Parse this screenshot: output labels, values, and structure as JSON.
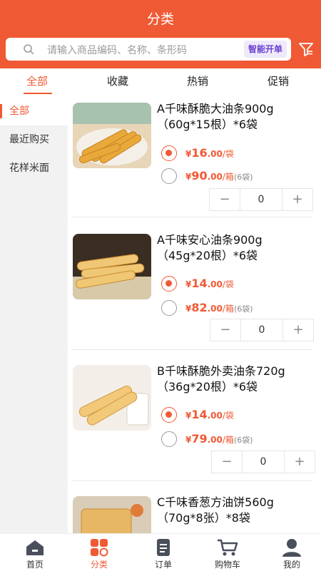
{
  "header": {
    "title": "分类"
  },
  "search": {
    "placeholder": "请输入商品编码、名称、条形码",
    "smart_button": "智能开单"
  },
  "icons": {
    "search": "search-icon",
    "filter": "filter-icon"
  },
  "colors": {
    "accent": "#ef5a34",
    "sidebar_bg": "#f2f2f2"
  },
  "tabs": [
    {
      "label": "全部",
      "active": true
    },
    {
      "label": "收藏",
      "active": false
    },
    {
      "label": "热销",
      "active": false
    },
    {
      "label": "促销",
      "active": false
    }
  ],
  "sidebar": {
    "items": [
      {
        "label": "全部",
        "active": true
      },
      {
        "label": "最近购买",
        "active": false
      },
      {
        "label": "花样米面",
        "active": false
      }
    ]
  },
  "products": [
    {
      "name": "A千味酥脆大油条900g（60g*15根）*6袋",
      "prices": [
        {
          "currency": "¥",
          "int": "16",
          "dec": ".00",
          "unit": "/袋",
          "note": "",
          "selected": true
        },
        {
          "currency": "¥",
          "int": "90",
          "dec": ".00",
          "unit": "/箱",
          "note": "(6袋)",
          "selected": false
        }
      ],
      "qty": "0"
    },
    {
      "name": "A千味安心油条900g（45g*20根）*6袋",
      "prices": [
        {
          "currency": "¥",
          "int": "14",
          "dec": ".00",
          "unit": "/袋",
          "note": "",
          "selected": true
        },
        {
          "currency": "¥",
          "int": "82",
          "dec": ".00",
          "unit": "/箱",
          "note": "(6袋)",
          "selected": false
        }
      ],
      "qty": "0"
    },
    {
      "name": "B千味酥脆外卖油条720g（36g*20根）*6袋",
      "prices": [
        {
          "currency": "¥",
          "int": "14",
          "dec": ".00",
          "unit": "/袋",
          "note": "",
          "selected": true
        },
        {
          "currency": "¥",
          "int": "79",
          "dec": ".00",
          "unit": "/箱",
          "note": "(6袋)",
          "selected": false
        }
      ],
      "qty": "0"
    },
    {
      "name": "C千味香葱方油饼560g（70g*8张）*8袋",
      "prices": [],
      "qty": ""
    }
  ],
  "stepper": {
    "minus": "−",
    "plus": "+"
  },
  "bottom_nav": [
    {
      "label": "首页",
      "icon": "home-icon",
      "active": false
    },
    {
      "label": "分类",
      "icon": "category-icon",
      "active": true
    },
    {
      "label": "订单",
      "icon": "order-icon",
      "active": false
    },
    {
      "label": "购物车",
      "icon": "cart-icon",
      "active": false
    },
    {
      "label": "我的",
      "icon": "profile-icon",
      "active": false
    }
  ]
}
